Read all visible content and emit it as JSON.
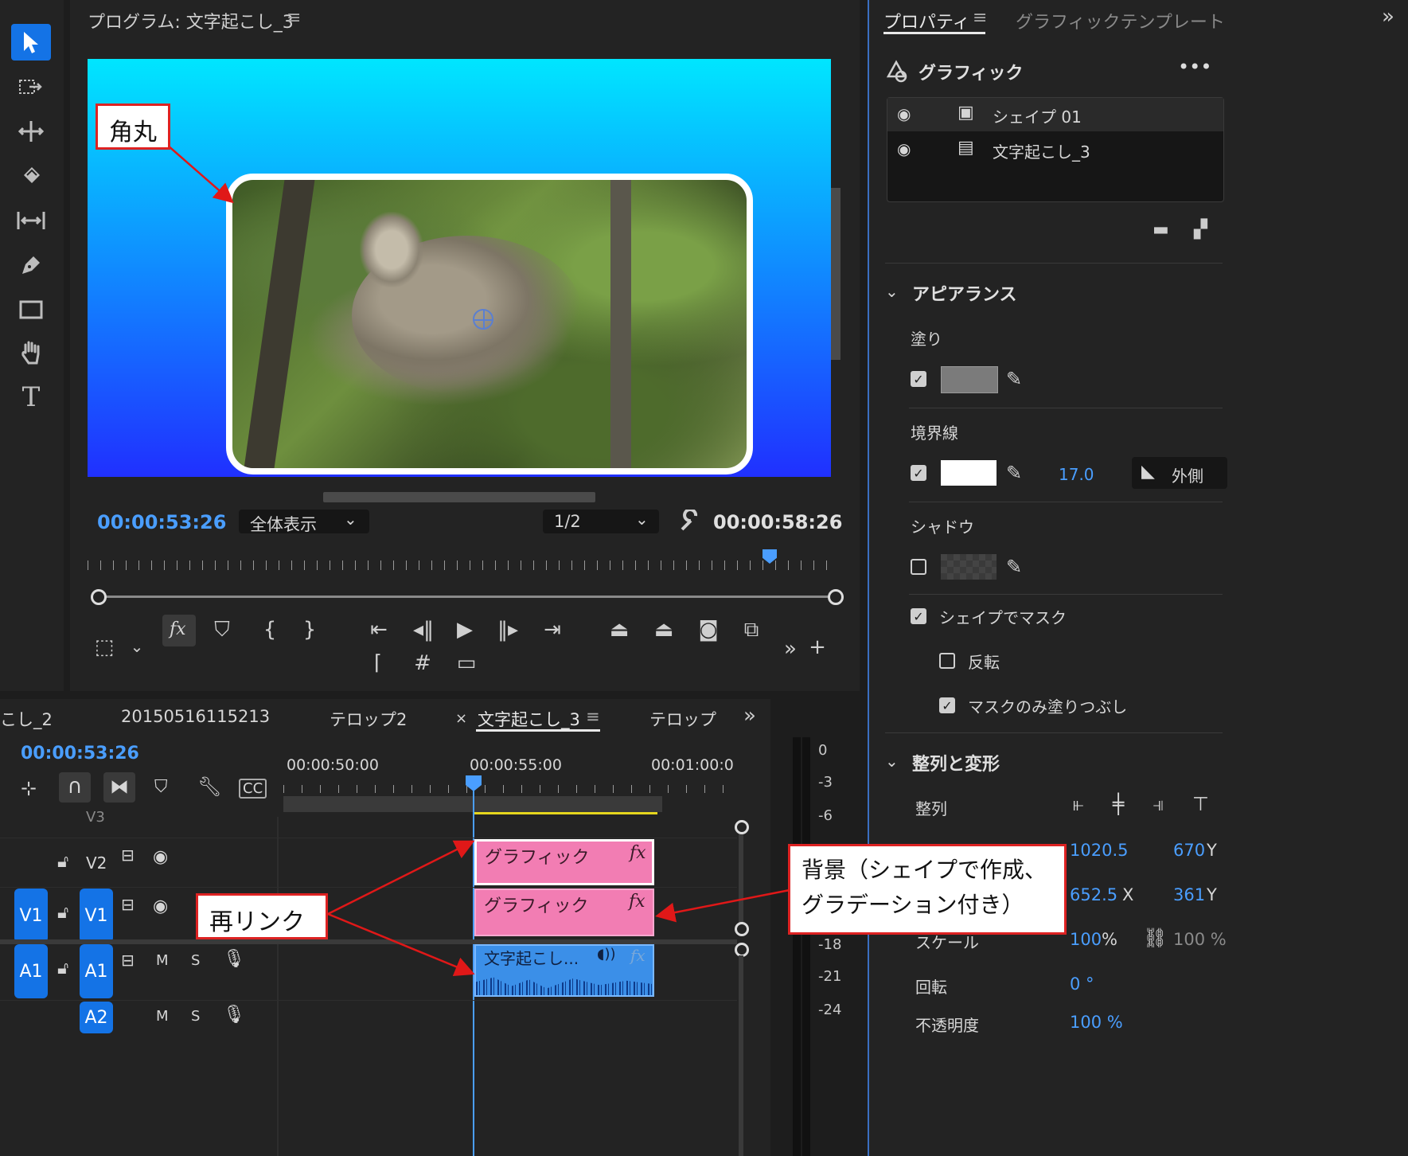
{
  "tools": [
    "selection-tool",
    "track-select-tool",
    "ripple-edit-tool",
    "razor-tool",
    "slip-tool",
    "pen-tool",
    "rectangle-tool",
    "hand-tool",
    "type-tool"
  ],
  "program": {
    "title": "プログラム: 文字起こし_3",
    "timecode_current": "00:00:53:26",
    "zoom": "全体表示",
    "resolution": "1/2",
    "timecode_duration": "00:00:58:26",
    "fx_label": "fx"
  },
  "properties": {
    "tab_active": "プロパティ",
    "tab_other": "グラフィックテンプレート",
    "section_title": "グラフィック",
    "layers": [
      {
        "name": "シェイプ 01"
      },
      {
        "name": "文字起こし_3"
      }
    ],
    "appearance": {
      "header": "アピアランス",
      "fill_label": "塗り",
      "fill_color": "#7b7b7b",
      "stroke_label": "境界線",
      "stroke_color": "#ffffff",
      "stroke_width": "17.0",
      "stroke_position": "外側",
      "shadow_label": "シャドウ",
      "mask_label": "シェイプでマスク",
      "invert_label": "反転",
      "mask_fill_label": "マスクのみ塗りつぶし"
    },
    "align": {
      "header": "整列と変形",
      "align_label": "整列",
      "pos1_x": "1020.5",
      "pos1_y": "670",
      "pos1_y_unit": "Y",
      "pos2_x": "652.5",
      "pos2_x_unit": "X",
      "pos2_y": "361",
      "pos2_y_unit": "Y",
      "scale_label": "スケール",
      "scale_value": "100",
      "scale_unit": "%",
      "scale_value2": "100 %",
      "rotation_label": "回転",
      "rotation_value": "0 °",
      "opacity_label": "不透明度",
      "opacity_value": "100 %"
    }
  },
  "timeline": {
    "tabs": [
      "こし_2",
      "20150516115213",
      "テロップ2",
      "文字起こし_3",
      "テロップ"
    ],
    "close_mark": "×",
    "timecode": "00:00:53:26",
    "ruler": [
      "00:00:50:00",
      "00:00:55:00",
      "00:01:00:0"
    ],
    "tracks": {
      "v3": "V3",
      "v2": "V2",
      "v1": "V1",
      "a1": "A1",
      "a2": "A2",
      "m": "M",
      "s": "S"
    },
    "clips": [
      {
        "label": "グラフィック",
        "fx": "fx"
      },
      {
        "label": "グラフィック",
        "fx": "fx"
      },
      {
        "label": "文字起こし...",
        "fx": "fx"
      }
    ]
  },
  "meter": [
    "0",
    "-3",
    "-6",
    "-18",
    "-21",
    "-24"
  ],
  "callouts": {
    "corner": "角丸",
    "relink": "再リンク",
    "background": "背景（シェイプで作成、\nグラデーション付き）"
  }
}
